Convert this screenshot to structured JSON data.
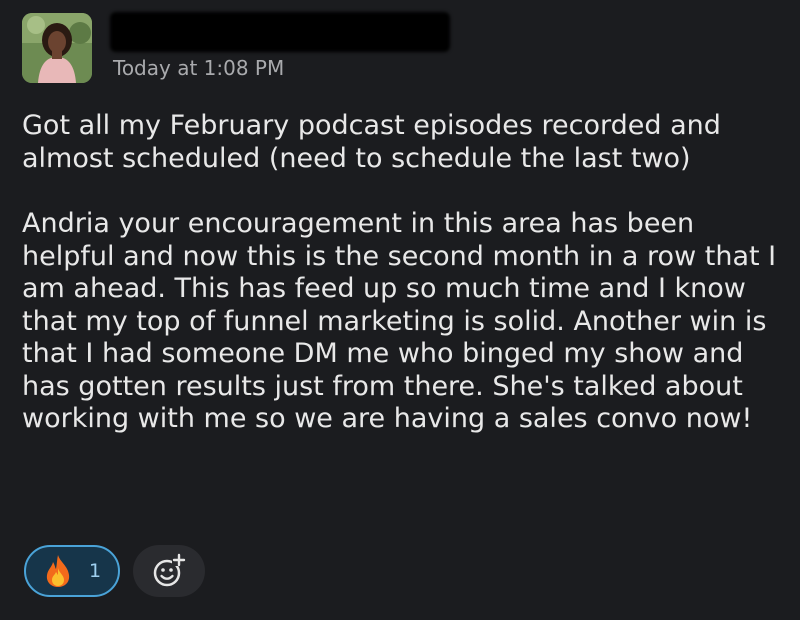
{
  "message": {
    "timestamp": "Today at 1:08 PM",
    "paragraphs": [
      "Got all my February podcast episodes recorded and almost scheduled (need to schedule the last two)",
      "Andria your encouragement in this area has been helpful and now this is the second month in a row that I am ahead. This has feed up so much time and I know that my top of funnel marketing is solid. Another win is that I had someone DM me who binged my show and has gotten results just from there. She's talked about working with me so we are having a sales convo now!"
    ]
  },
  "reactions": [
    {
      "emoji": "fire-icon",
      "count": "1"
    }
  ],
  "add_reaction_icon": "add-reaction-icon",
  "colors": {
    "background": "#1b1c1f",
    "reaction_border": "#4aa3d8",
    "reaction_bg": "#16354a"
  }
}
